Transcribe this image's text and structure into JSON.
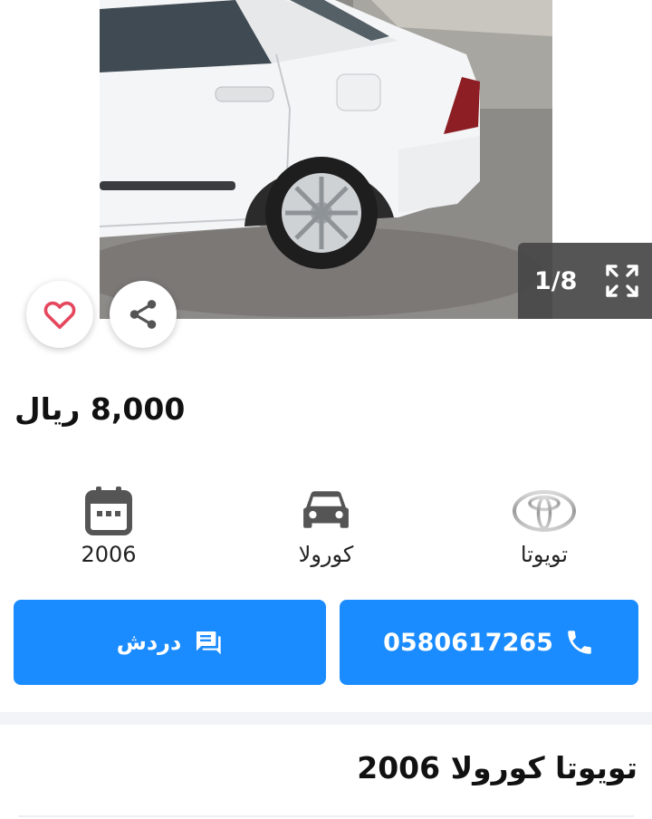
{
  "gallery": {
    "counter": "1/8",
    "prev_icon": "chevron-left-icon",
    "next_icon": "chevron-right-icon",
    "fullscreen_icon": "fullscreen-expand-icon",
    "favorite_icon": "heart-outline-icon",
    "share_icon": "share-icon"
  },
  "listing": {
    "price": "8,000",
    "currency": "ريال",
    "title": "تويوتا كورولا 2006"
  },
  "specs": {
    "year": {
      "icon": "calendar-icon",
      "value": "2006"
    },
    "model": {
      "icon": "car-icon",
      "value": "كورولا"
    },
    "make": {
      "icon": "toyota-logo-icon",
      "value": "تويوتا"
    }
  },
  "actions": {
    "call": {
      "label": "0580617265",
      "icon": "phone-icon"
    },
    "chat": {
      "label": "دردش",
      "icon": "chat-bubble-icon"
    }
  },
  "colors": {
    "primary": "#1a8cff",
    "heart": "#e5485e",
    "icon_gray": "#555555",
    "divider": "#f1f3f6"
  }
}
